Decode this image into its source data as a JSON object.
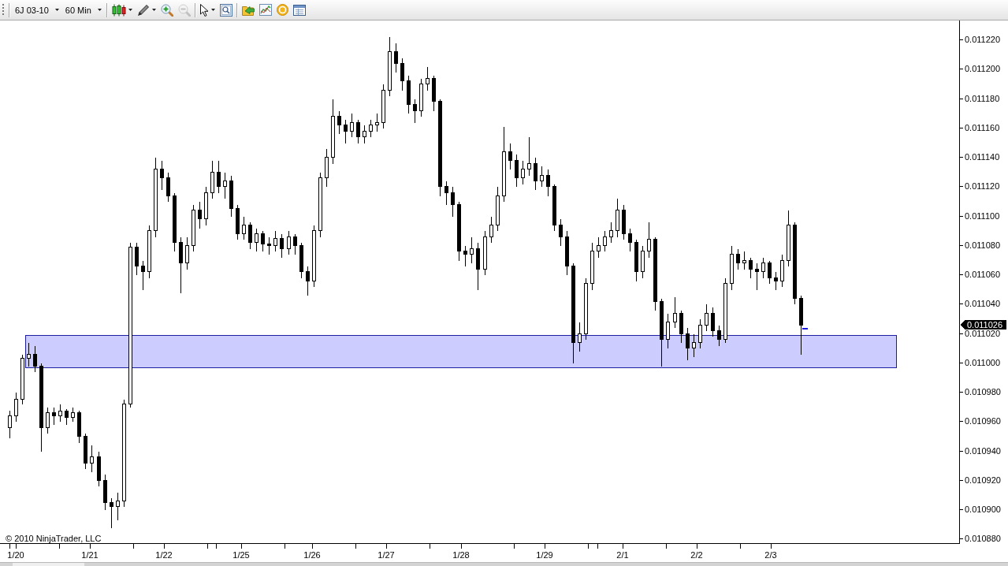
{
  "toolbar": {
    "instrument": "6J 03-10",
    "interval": "60 Min",
    "zoom_in": {
      "disabled": false
    },
    "zoom_out": {
      "disabled": true
    }
  },
  "chart": {
    "price_axis": {
      "labels": [
        "0.011220",
        "0.011200",
        "0.011180",
        "0.011160",
        "0.011140",
        "0.011120",
        "0.011100",
        "0.011080",
        "0.011060",
        "0.011040",
        "0.011020",
        "0.011000",
        "0.010980",
        "0.010960",
        "0.010940",
        "0.010920",
        "0.010900",
        "0.010880"
      ]
    },
    "last_price": "0.011026",
    "time_axis": {
      "labels": [
        "1/20",
        "1/21",
        "1/22",
        "1/25",
        "1/26",
        "1/27",
        "1/28",
        "1/29",
        "2/1",
        "2/2",
        "2/3"
      ]
    },
    "copyright": "© 2010 NinjaTrader, LLC"
  }
}
